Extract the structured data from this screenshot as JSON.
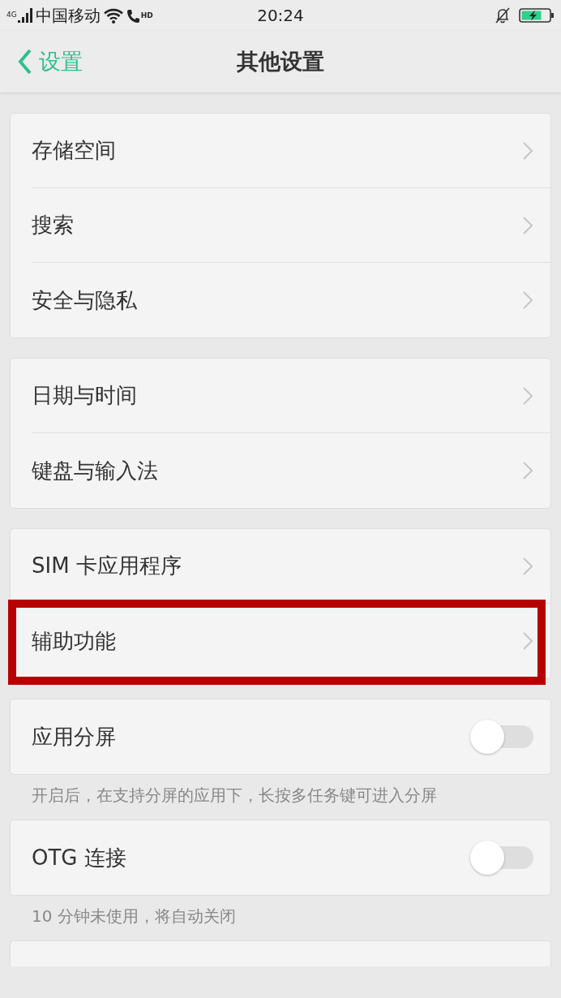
{
  "status_bar": {
    "network_type": "4G",
    "carrier": "中国移动",
    "call_badge": "HD",
    "time": "20:24"
  },
  "nav_bar": {
    "back_label": "设置",
    "title": "其他设置"
  },
  "groups": [
    {
      "items": [
        {
          "kind": "link",
          "label": "存储空间",
          "highlighted": false
        },
        {
          "kind": "link",
          "label": "搜索",
          "highlighted": false
        },
        {
          "kind": "link",
          "label": "安全与隐私",
          "highlighted": false
        }
      ]
    },
    {
      "items": [
        {
          "kind": "link",
          "label": "日期与时间",
          "highlighted": false
        },
        {
          "kind": "link",
          "label": "键盘与输入法",
          "highlighted": false
        }
      ]
    },
    {
      "items": [
        {
          "kind": "link",
          "label": "SIM 卡应用程序",
          "highlighted": false
        },
        {
          "kind": "link",
          "label": "辅助功能",
          "highlighted": true
        }
      ]
    },
    {
      "items": [
        {
          "kind": "toggle",
          "label": "应用分屏",
          "on": false,
          "highlighted": false
        }
      ],
      "note": "开启后，在支持分屏的应用下，长按多任务键可进入分屏"
    },
    {
      "items": [
        {
          "kind": "toggle",
          "label": "OTG 连接",
          "on": false,
          "highlighted": false
        }
      ],
      "note": "10 分钟未使用，将自动关闭"
    }
  ],
  "partial_group_below": true
}
